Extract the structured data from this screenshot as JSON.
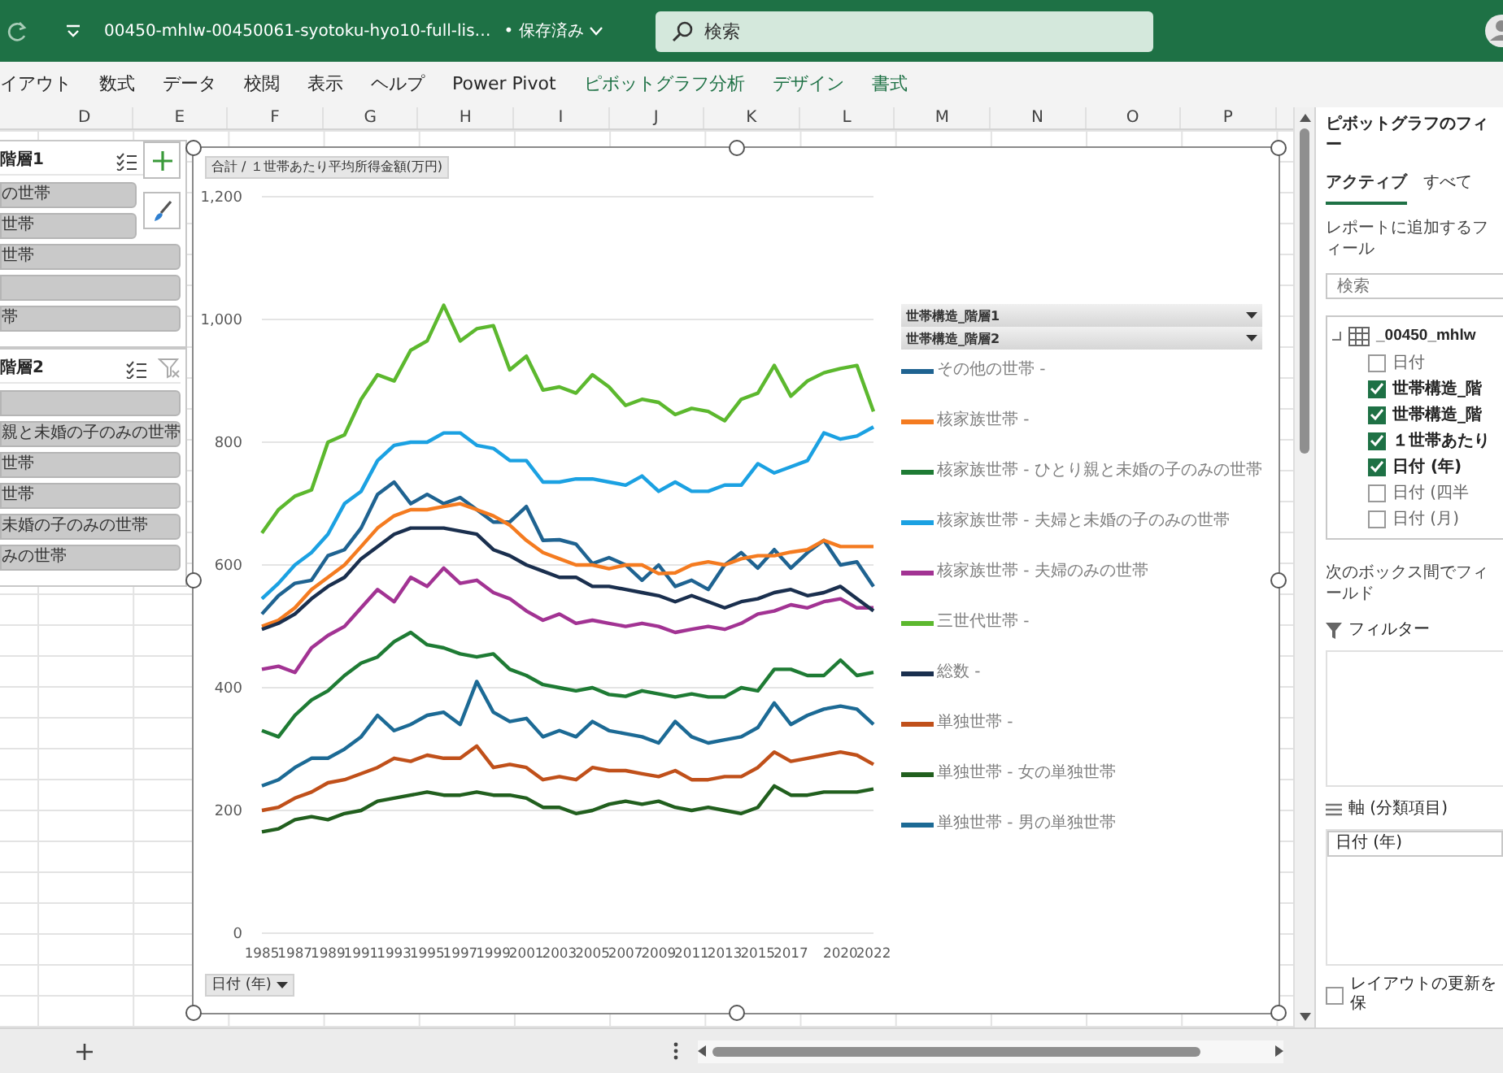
{
  "title_bar": {
    "file_name": "00450-mhlw-00450061-syotoku-hyo10-full-lis…",
    "save_status": "• 保存済み",
    "search": {
      "placeholder": "検索"
    }
  },
  "ribbon_tabs": [
    {
      "label": "イアウト",
      "contextual": false
    },
    {
      "label": "数式",
      "contextual": false
    },
    {
      "label": "データ",
      "contextual": false
    },
    {
      "label": "校閲",
      "contextual": false
    },
    {
      "label": "表示",
      "contextual": false
    },
    {
      "label": "ヘルプ",
      "contextual": false
    },
    {
      "label": "Power Pivot",
      "contextual": false
    },
    {
      "label": "ピボットグラフ分析",
      "contextual": true
    },
    {
      "label": "デザイン",
      "contextual": true
    },
    {
      "label": "書式",
      "contextual": true
    }
  ],
  "columns": [
    "D",
    "E",
    "F",
    "G",
    "H",
    "I",
    "J",
    "K",
    "L",
    "M",
    "N",
    "O",
    "P"
  ],
  "slicers": [
    {
      "title": "階層1",
      "items": [
        {
          "kind": "label",
          "label": "の世帯"
        },
        {
          "kind": "label",
          "label": "世帯"
        },
        {
          "kind": "label",
          "label": "世帯"
        },
        {
          "kind": "blank"
        },
        {
          "kind": "label",
          "label": "帯"
        }
      ]
    },
    {
      "title": "階層2",
      "items": [
        {
          "kind": "blank"
        },
        {
          "kind": "label",
          "label": "親と未婚の子のみの世帯"
        },
        {
          "kind": "label",
          "label": "世帯"
        },
        {
          "kind": "label",
          "label": "世帯"
        },
        {
          "kind": "label",
          "label": "未婚の子のみの世帯"
        },
        {
          "kind": "label",
          "label": "みの世帯"
        }
      ]
    }
  ],
  "chart": {
    "field_button": "合計 / １世帯あたり平均所得金額(万円)",
    "axis_field_button": "日付 (年)",
    "legend_field_buttons": [
      "世帯構造_階層1",
      "世帯構造_階層2"
    ],
    "chart_data": {
      "type": "line",
      "grid": true,
      "x": [
        1985,
        1986,
        1987,
        1988,
        1989,
        1990,
        1991,
        1992,
        1993,
        1994,
        1995,
        1996,
        1997,
        1998,
        1999,
        2000,
        2001,
        2002,
        2003,
        2004,
        2005,
        2006,
        2007,
        2008,
        2009,
        2010,
        2011,
        2012,
        2013,
        2014,
        2015,
        2016,
        2017,
        2018,
        2019,
        2020,
        2021,
        2022
      ],
      "xticks": [
        1985,
        1987,
        1989,
        1991,
        1993,
        1995,
        1997,
        1999,
        2001,
        2003,
        2005,
        2007,
        2009,
        2011,
        2013,
        2015,
        2017,
        2020,
        2022
      ],
      "xlim": [
        1985,
        2022
      ],
      "ylim": [
        0,
        1200
      ],
      "yticks": [
        {
          "value": 0,
          "label": "0"
        },
        {
          "value": 200,
          "label": "200"
        },
        {
          "value": 400,
          "label": "400"
        },
        {
          "value": 600,
          "label": "600"
        },
        {
          "value": 800,
          "label": "800"
        },
        {
          "value": 1000,
          "label": "1,000"
        },
        {
          "value": 1200,
          "label": "1,200"
        }
      ],
      "series": [
        {
          "name": "その他の世帯 -",
          "color": "#1f6391",
          "values": [
            520,
            550,
            570,
            575,
            615,
            625,
            660,
            715,
            735,
            700,
            715,
            700,
            710,
            690,
            670,
            670,
            695,
            640,
            641,
            634,
            602,
            612,
            600,
            575,
            600,
            565,
            575,
            560,
            600,
            620,
            595,
            625,
            595,
            620,
            640,
            600,
            605,
            565
          ]
        },
        {
          "name": "核家族世帯 -",
          "color": "#f47b20",
          "values": [
            500,
            510,
            530,
            560,
            580,
            600,
            630,
            660,
            680,
            690,
            690,
            695,
            700,
            690,
            680,
            665,
            640,
            620,
            610,
            600,
            600,
            594,
            600,
            600,
            586,
            587,
            600,
            605,
            600,
            610,
            615,
            615,
            621,
            625,
            640,
            630,
            630,
            630
          ]
        },
        {
          "name": "核家族世帯 - ひとり親と未婚の子のみの世帯",
          "color": "#1e7b34",
          "values": [
            330,
            320,
            355,
            380,
            395,
            420,
            440,
            450,
            475,
            490,
            470,
            465,
            455,
            450,
            455,
            430,
            420,
            405,
            400,
            395,
            400,
            389,
            386,
            395,
            390,
            385,
            390,
            385,
            385,
            400,
            395,
            430,
            430,
            420,
            420,
            445,
            420,
            425
          ]
        },
        {
          "name": "核家族世帯 - 夫婦と未婚の子のみの世帯",
          "color": "#1ba1e2",
          "values": [
            545,
            570,
            600,
            620,
            650,
            700,
            720,
            770,
            795,
            800,
            800,
            815,
            815,
            795,
            790,
            770,
            770,
            735,
            735,
            740,
            740,
            735,
            730,
            745,
            720,
            735,
            720,
            720,
            730,
            730,
            765,
            750,
            760,
            770,
            815,
            805,
            810,
            825
          ]
        },
        {
          "name": "核家族世帯 - 夫婦のみの世帯",
          "color": "#a23393",
          "values": [
            430,
            435,
            425,
            465,
            485,
            500,
            530,
            560,
            540,
            580,
            565,
            595,
            570,
            575,
            555,
            545,
            525,
            510,
            520,
            505,
            510,
            505,
            500,
            505,
            500,
            490,
            495,
            500,
            495,
            505,
            520,
            525,
            535,
            530,
            540,
            545,
            530,
            530
          ]
        },
        {
          "name": "三世代世帯 -",
          "color": "#5cb82e",
          "values": [
            652,
            690,
            712,
            722,
            800,
            812,
            870,
            910,
            900,
            950,
            965,
            1023,
            965,
            985,
            990,
            918,
            940,
            885,
            890,
            880,
            910,
            890,
            860,
            870,
            865,
            845,
            855,
            850,
            835,
            870,
            880,
            925,
            875,
            900,
            913,
            920,
            925,
            850
          ]
        },
        {
          "name": "総数 -",
          "color": "#1a2f4e",
          "values": [
            495,
            505,
            520,
            545,
            565,
            580,
            610,
            630,
            650,
            660,
            660,
            660,
            655,
            650,
            625,
            615,
            600,
            590,
            580,
            580,
            565,
            565,
            560,
            555,
            550,
            540,
            550,
            540,
            530,
            540,
            545,
            555,
            560,
            550,
            555,
            565,
            545,
            525
          ]
        },
        {
          "name": "単独世帯 -",
          "color": "#c0501a",
          "values": [
            200,
            205,
            220,
            230,
            245,
            250,
            260,
            270,
            285,
            280,
            290,
            285,
            285,
            305,
            270,
            275,
            270,
            250,
            255,
            250,
            270,
            265,
            265,
            260,
            255,
            265,
            250,
            250,
            255,
            255,
            270,
            295,
            280,
            285,
            290,
            295,
            290,
            275
          ]
        },
        {
          "name": "単独世帯 - 女の単独世帯",
          "color": "#215f1e",
          "values": [
            165,
            170,
            185,
            190,
            185,
            195,
            200,
            215,
            220,
            225,
            230,
            225,
            225,
            230,
            225,
            225,
            220,
            205,
            205,
            195,
            200,
            210,
            215,
            210,
            215,
            205,
            200,
            205,
            200,
            195,
            205,
            240,
            225,
            225,
            230,
            230,
            230,
            235
          ]
        },
        {
          "name": "単独世帯 - 男の単独世帯",
          "color": "#1c6a95",
          "values": [
            240,
            250,
            270,
            285,
            285,
            300,
            320,
            355,
            330,
            340,
            355,
            360,
            340,
            410,
            360,
            345,
            350,
            320,
            330,
            320,
            345,
            330,
            325,
            320,
            310,
            345,
            320,
            310,
            315,
            320,
            335,
            375,
            340,
            355,
            365,
            370,
            365,
            340
          ]
        }
      ]
    }
  },
  "field_list": {
    "title": "ピボットグラフのフィー",
    "tabs": [
      {
        "label": "アクティブ",
        "selected": true
      },
      {
        "label": "すべて",
        "selected": false
      }
    ],
    "instruction": "レポートに追加するフィール",
    "search": {
      "placeholder": "検索"
    },
    "table_name": "_00450_mhlw",
    "fields": [
      {
        "label": "日付",
        "checked": false
      },
      {
        "label": "世帯構造_階",
        "checked": true
      },
      {
        "label": "世帯構造_階",
        "checked": true
      },
      {
        "label": "１世帯あたり",
        "checked": true
      },
      {
        "label": "日付 (年)",
        "checked": true
      },
      {
        "label": "日付 (四半",
        "checked": false
      },
      {
        "label": "日付 (月)",
        "checked": false
      }
    ],
    "areas_hint": "次のボックス間でフィールド",
    "areas": [
      {
        "kind": "filter",
        "label": "フィルター"
      },
      {
        "kind": "axis",
        "label": "軸 (分類項目)",
        "items": [
          "日付 (年)"
        ]
      }
    ],
    "defer_update": {
      "label": "レイアウトの更新を保",
      "checked": false
    }
  }
}
